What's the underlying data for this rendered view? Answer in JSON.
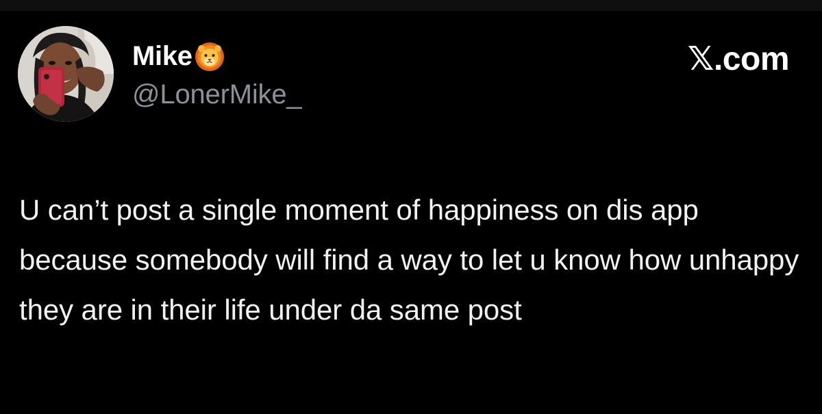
{
  "post": {
    "author": {
      "display_name": "Mike",
      "badge_icon": "lion-face-emoji",
      "handle": "@LonerMike_",
      "avatar": "profile-photo"
    },
    "watermark": "𝕏.com",
    "text": "U can’t post a single moment of happiness on dis app because somebody will find a way to let u know how unhappy they are in their life under da same post"
  },
  "colors": {
    "background": "#000000",
    "primary_text": "#e7e9ea",
    "secondary_text": "#8b9196"
  }
}
